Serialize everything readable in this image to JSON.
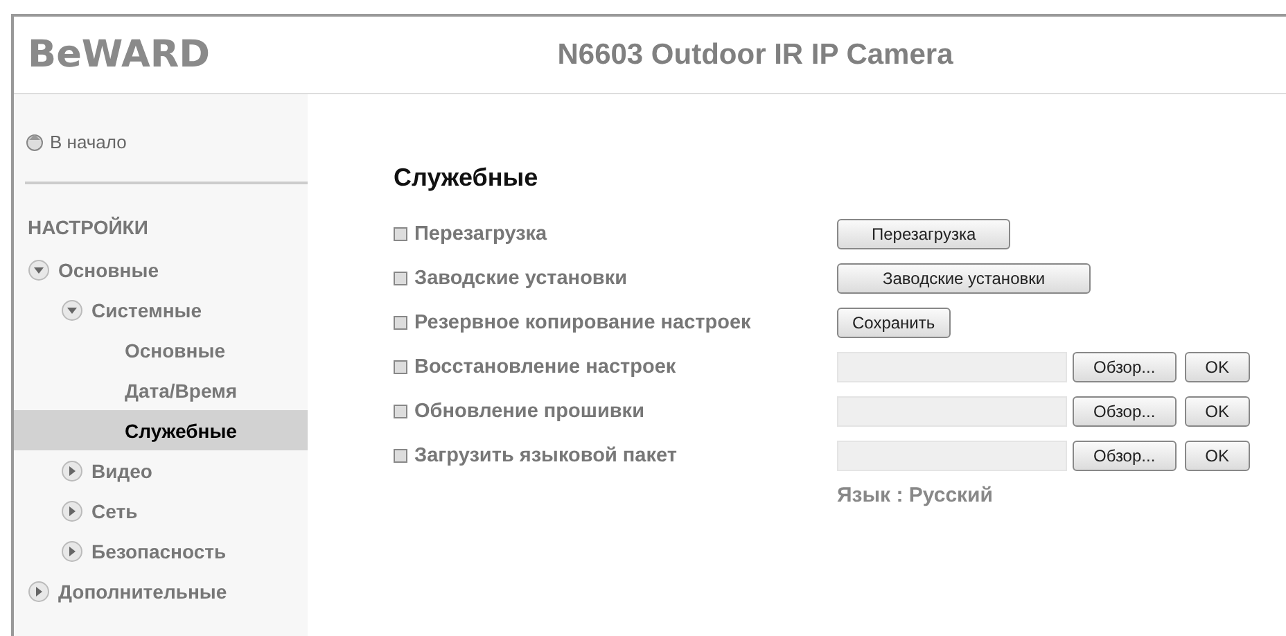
{
  "header": {
    "logo": "BeWARD",
    "title": "N6603 Outdoor IR IP Camera"
  },
  "sidebar": {
    "home": "В начало",
    "section": "НАСТРОЙКИ",
    "tree": [
      {
        "label": "Основные",
        "expanded": true,
        "selected": false,
        "children": [
          {
            "label": "Системные",
            "expanded": true,
            "selected": false,
            "children": [
              {
                "label": "Основные",
                "selected": false
              },
              {
                "label": "Дата/Время",
                "selected": false
              },
              {
                "label": "Служебные",
                "selected": true
              }
            ]
          },
          {
            "label": "Видео",
            "expanded": false,
            "selected": false
          },
          {
            "label": "Сеть",
            "expanded": false,
            "selected": false
          },
          {
            "label": "Безопасность",
            "expanded": false,
            "selected": false
          }
        ]
      },
      {
        "label": "Дополнительные",
        "expanded": false,
        "selected": false
      }
    ]
  },
  "main": {
    "title": "Служебные",
    "rows": [
      {
        "kind": "button",
        "label": "Перезагрузка",
        "button": "Перезагрузка"
      },
      {
        "kind": "button",
        "label": "Заводские установки",
        "button": "Заводские установки"
      },
      {
        "kind": "button",
        "label": "Резервное копирование настроек",
        "button": "Сохранить"
      },
      {
        "kind": "file",
        "label": "Восстановление настроек",
        "browse": "Обзор...",
        "ok": "OK"
      },
      {
        "kind": "file",
        "label": "Обновление прошивки",
        "browse": "Обзор...",
        "ok": "OK"
      },
      {
        "kind": "file",
        "label": "Загрузить языковой пакет",
        "browse": "Обзор...",
        "ok": "OK"
      }
    ],
    "language": "Язык : Русский"
  }
}
